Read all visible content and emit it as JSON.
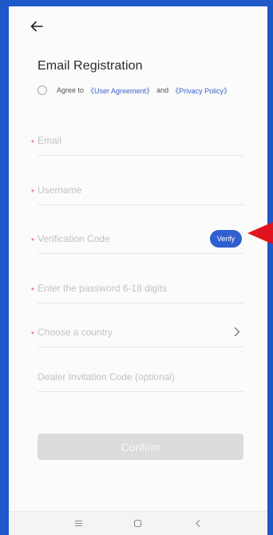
{
  "header": {
    "back_icon": "arrow-left-icon"
  },
  "page": {
    "title": "Email Registration"
  },
  "agreement": {
    "prefix": "Agree to",
    "user_agreement": "《User Agreement》",
    "and": "and",
    "privacy_policy": "《Privacy Policy》",
    "checked": false
  },
  "form": {
    "required_mark": "*",
    "email_placeholder": "Email",
    "username_placeholder": "Username",
    "verification_placeholder": "Verification Code",
    "verify_label": "Verify",
    "password_placeholder": "Enter the password 6-18 digits",
    "country_placeholder": "Choose a country",
    "dealer_placeholder": "Dealer Invitation Code (optional)"
  },
  "confirm_label": "Confirm",
  "navbar": {
    "icons": [
      "menu-icon",
      "home-square-icon",
      "back-chevron-icon"
    ]
  },
  "colors": {
    "frame": "#1f58c8",
    "accent": "#2f5fd0",
    "link": "#3a62c9",
    "required": "#e05050",
    "annotation": "#e0141e",
    "confirm_disabled": "#dcdcdc"
  }
}
